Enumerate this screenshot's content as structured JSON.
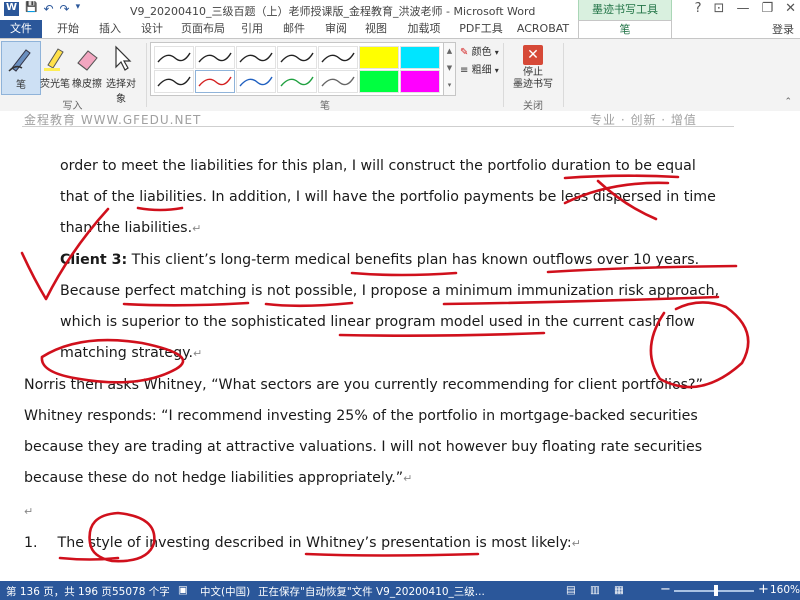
{
  "titlebar": {
    "qat": [
      "W",
      "💾",
      "↶",
      "↷",
      "▾"
    ],
    "title": "V9_20200410_三级百题（上）老师授课版_金程教育_洪波老师 - Microsoft Word",
    "context_group": "墨迹书写工具",
    "window_buttons": [
      "?",
      "⊡",
      "—",
      "❐",
      "✕"
    ]
  },
  "tabs": {
    "file": "文件",
    "items": [
      "开始",
      "插入",
      "设计",
      "页面布局",
      "引用",
      "邮件",
      "审阅",
      "视图",
      "加载项",
      "PDF工具",
      "ACROBAT"
    ],
    "context_tab": "笔",
    "login": "登录"
  },
  "ribbon": {
    "write_group": {
      "label": "写入",
      "pen": "笔",
      "highlighter": "荧光笔",
      "eraser": "橡皮擦",
      "select": "选择对象"
    },
    "pen_group": {
      "label": "笔",
      "color_label": "颜色",
      "thickness_label": "粗细",
      "swatches": [
        {
          "color": "#222222"
        },
        {
          "color": "#222222"
        },
        {
          "color": "#222222"
        },
        {
          "color": "#222222"
        },
        {
          "color": "#222222"
        },
        {
          "color": "#ffff00"
        },
        {
          "color": "#00e5ff"
        },
        {
          "color": "#222222"
        },
        {
          "color": "#d42020"
        },
        {
          "color": "#2060c0"
        },
        {
          "color": "#20a040"
        },
        {
          "color": "#666666"
        },
        {
          "color": "#00ff40"
        },
        {
          "color": "#ff00ff"
        }
      ]
    },
    "close_group": {
      "label": "关闭",
      "stop_button": "停止\n墨迹书写"
    }
  },
  "document": {
    "header_left": "金程教育 WWW.GFEDU.NET",
    "header_right": "专业 · 创新 · 增值",
    "lines": [
      {
        "text": "order to meet the liabilities for this plan, I will construct the portfolio duration to be equal"
      },
      {
        "text": "that of the liabilities. In addition, I will have the portfolio payments be less dispersed in time"
      },
      {
        "text": "than the liabilities."
      },
      {
        "bold": "Client 3:",
        "text": " This client’s long-term medical benefits plan has known outflows over 10 years."
      },
      {
        "text": "Because perfect matching is not possible, I propose a minimum immunization risk approach,"
      },
      {
        "text": "which is superior to the sophisticated linear program model used in the current cash flow"
      },
      {
        "text": "matching strategy."
      },
      {
        "text": "Norris then asks Whitney, “What sectors are you currently recommending for client portfolios?”"
      },
      {
        "text": "Whitney responds: “I recommend investing 25% of the portfolio in mortgage-backed securities"
      },
      {
        "text": "because they are trading at attractive valuations. I will not however buy floating rate securities"
      },
      {
        "text": "because these do not hedge liabilities appropriately.”"
      },
      {
        "number": "1.",
        "text": "The style of investing described in Whitney’s presentation is most likely:"
      }
    ],
    "ink_color": "#d0101c"
  },
  "status": {
    "page": "第 136 页，共 196 页",
    "words": "55078 个字",
    "language": "中文(中国)",
    "saving": "正在保存\"自动恢复\"文件 V9_20200410_三级...",
    "zoom": "160%",
    "zoom_minus": "−",
    "zoom_plus": "+"
  }
}
